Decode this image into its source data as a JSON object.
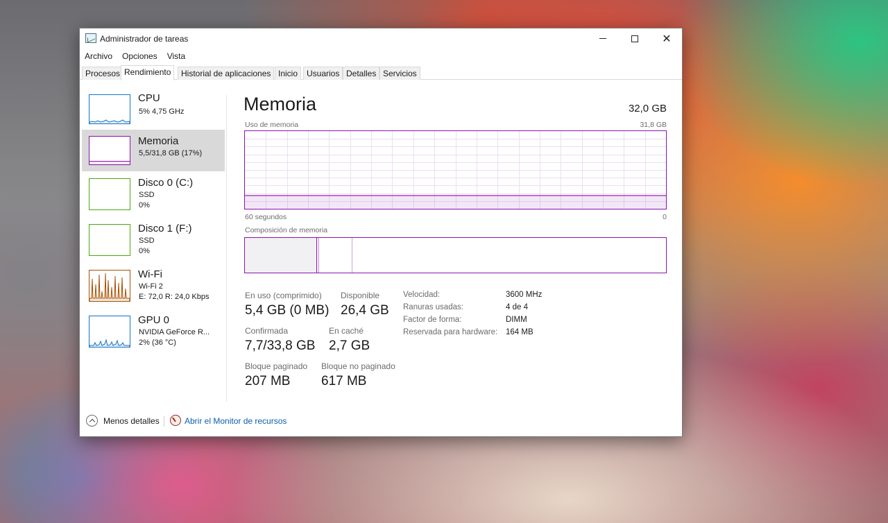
{
  "window": {
    "title": "Administrador de tareas"
  },
  "menu": [
    "Archivo",
    "Opciones",
    "Vista"
  ],
  "tabs": [
    {
      "label": "Procesos",
      "active": false
    },
    {
      "label": "Rendimiento",
      "active": true
    },
    {
      "label": "Historial de aplicaciones",
      "active": false
    },
    {
      "label": "Inicio",
      "active": false
    },
    {
      "label": "Usuarios",
      "active": false
    },
    {
      "label": "Detalles",
      "active": false
    },
    {
      "label": "Servicios",
      "active": false
    }
  ],
  "sidebar": {
    "items": [
      {
        "name": "CPU",
        "sub1": "5% 4,75 GHz",
        "sub2": "",
        "sub3": "",
        "color": "#1173c4"
      },
      {
        "name": "Memoria",
        "sub1": "5,5/31,8 GB (17%)",
        "sub2": "",
        "sub3": "",
        "color": "#8b12ae",
        "active": true
      },
      {
        "name": "Disco 0 (C:)",
        "sub1": "SSD",
        "sub2": "0%",
        "sub3": "",
        "color": "#4da60c"
      },
      {
        "name": "Disco 1 (F:)",
        "sub1": "SSD",
        "sub2": "0%",
        "sub3": "",
        "color": "#4da60c"
      },
      {
        "name": "Wi-Fi",
        "sub1": "Wi-Fi 2",
        "sub2": "E: 72,0  R: 24,0 Kbps",
        "sub3": "",
        "color": "#a74f01"
      },
      {
        "name": "GPU 0",
        "sub1": "NVIDIA GeForce R...",
        "sub2": "2% (36 °C)",
        "sub3": "",
        "color": "#1173c4"
      }
    ]
  },
  "main": {
    "title": "Memoria",
    "total": "32,0 GB",
    "usage_label": "Uso de memoria",
    "usage_max": "31,8 GB",
    "axis_left": "60 segundos",
    "axis_right": "0",
    "composition_label": "Composición de memoria",
    "usage_fraction": 0.17
  },
  "stats": {
    "in_use_label": "En uso (comprimido)",
    "in_use_value": "5,4 GB (0 MB)",
    "available_label": "Disponible",
    "available_value": "26,4 GB",
    "committed_label": "Confirmada",
    "committed_value": "7,7/33,8 GB",
    "cached_label": "En caché",
    "cached_value": "2,7 GB",
    "paged_label": "Bloque paginado",
    "paged_value": "207 MB",
    "nonpaged_label": "Bloque no paginado",
    "nonpaged_value": "617 MB"
  },
  "info": [
    {
      "label": "Velocidad:",
      "value": "3600 MHz"
    },
    {
      "label": "Ranuras usadas:",
      "value": "4 de 4"
    },
    {
      "label": "Factor de forma:",
      "value": "DIMM"
    },
    {
      "label": "Reservada para hardware:",
      "value": "164 MB"
    }
  ],
  "footer": {
    "less_details": "Menos detalles",
    "resource_monitor": "Abrir el Monitor de recursos"
  },
  "colors": {
    "memory_accent": "#8b12ae",
    "link": "#0a5fb0"
  }
}
